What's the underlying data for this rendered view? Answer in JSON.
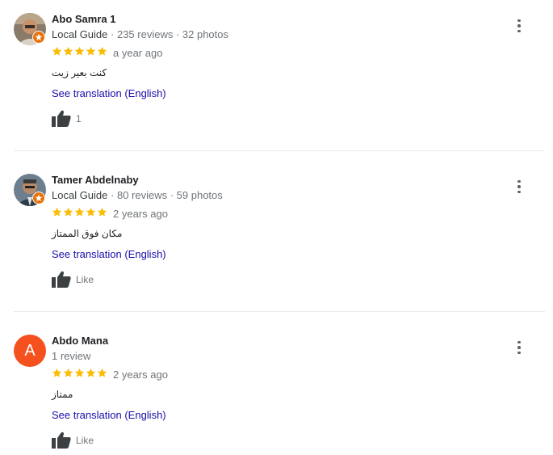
{
  "reviews": [
    {
      "name": "Abo Samra 1",
      "guide": "Local Guide",
      "stats": "235 reviews · 32 photos",
      "stars": 5,
      "date": "a year ago",
      "text": "كنت بعير زيت",
      "translation_link": "See translation (English)",
      "like_label": "1",
      "avatar_type": "photo",
      "local_guide": true
    },
    {
      "name": "Tamer Abdelnaby",
      "guide": "Local Guide",
      "stats": "80 reviews · 59 photos",
      "stars": 5,
      "date": "2 years ago",
      "text": "مكان فوق الممتاز",
      "translation_link": "See translation (English)",
      "like_label": "Like",
      "avatar_type": "photo",
      "local_guide": true
    },
    {
      "name": "Abdo Mana",
      "guide": "",
      "stats": "1 review",
      "stars": 5,
      "date": "2 years ago",
      "text": "ممتاز",
      "translation_link": "See translation (English)",
      "like_label": "Like",
      "avatar_type": "letter",
      "avatar_letter": "A",
      "local_guide": false
    }
  ],
  "colors": {
    "star": "#fbbc04",
    "link": "#1a0dab",
    "badge": "#e8710a",
    "letter_avatar": "#f4511e"
  }
}
